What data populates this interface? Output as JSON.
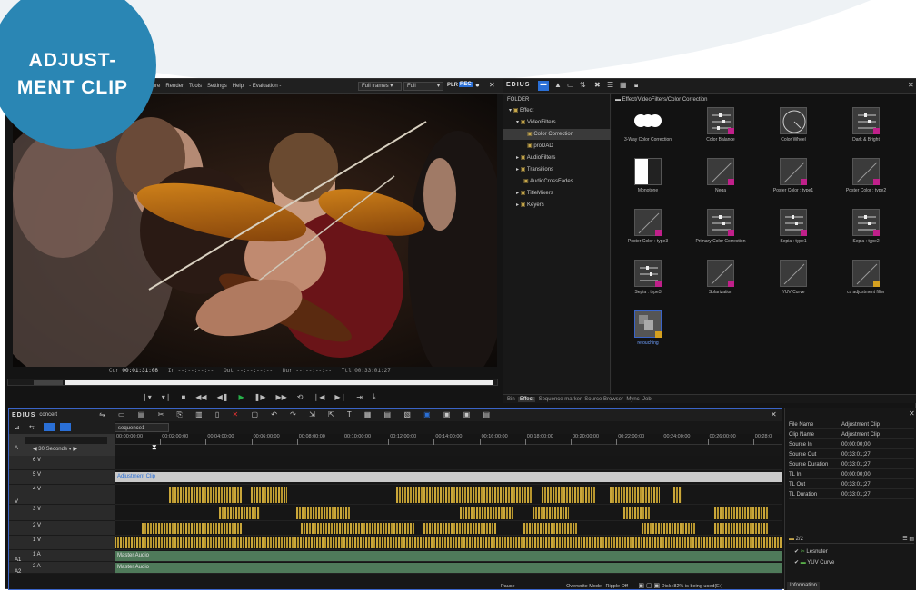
{
  "badge": {
    "line1": "ADJUST-",
    "line2": "MENT CLIP"
  },
  "player": {
    "menu": [
      "ture",
      "Render",
      "Tools",
      "Settings",
      "Help",
      "- Evaluation -"
    ],
    "frames_select": "Full frames",
    "quality_select": "Full",
    "plr": "PLR",
    "rec": "REC",
    "cur_label": "Cur",
    "cur_value": "00:01:31:08",
    "in_label": "In",
    "in_value": "--:--:--:--",
    "out_label": "Out",
    "out_value": "--:--:--:--",
    "dur_label": "Dur",
    "dur_value": "--:--:--:--",
    "ttl_label": "Ttl",
    "ttl_value": "00:33:01:27"
  },
  "effects": {
    "app_name": "EDIUS",
    "folder_header": "FOLDER",
    "path": "Effect/VideoFilters/Color Correction",
    "tree": [
      "Effect",
      "VideoFilters",
      "Color Correction",
      "proDAD",
      "AudioFilters",
      "Transitions",
      "AudioCrossFades",
      "TitleMixers",
      "Keyers"
    ],
    "items": [
      "3-Way Color Correction",
      "Color Balance",
      "Color Wheel",
      "Dark & Bright",
      "Monotone",
      "Nega",
      "Poster Color : type1",
      "Poster Color : type2",
      "Poster Color : type3",
      "Primary Color Correction",
      "Sepia : type1",
      "Sepia : type2",
      "Sepia : type3",
      "Solarization",
      "YUV Curve",
      "cc adjustment filter",
      "retouching"
    ],
    "tabs": [
      "Bin",
      "Effect",
      "Sequence marker",
      "Source Browser",
      "Mync",
      "Job"
    ]
  },
  "timeline": {
    "title": "EDIUS",
    "project": "concert",
    "sequence": "sequence1",
    "scale": "30 Seconds",
    "ruler": [
      "00:00:00:00",
      "00:02:00:00",
      "00:04:00:00",
      "00:06:00:00",
      "00:08:00:00",
      "00:10:00:00",
      "00:12:00:00",
      "00:14:00:00",
      "00:16:00:00",
      "00:18:00:00",
      "00:20:00:00",
      "00:22:00:00",
      "00:24:00:00",
      "00:26:00:00",
      "00:28:0"
    ],
    "tracks": [
      "6 V",
      "5 V",
      "4 V",
      "3 V",
      "2 V",
      "1 V",
      "1 A",
      "2 A"
    ],
    "side_v": "V",
    "side_a": "A",
    "side_a1": "A1",
    "side_a2": "A2",
    "adjustment_clip": "Adjustment Clip",
    "master_audio_1": "Master Audio",
    "master_audio_2": "Master Audio"
  },
  "status": {
    "pause": "Pause",
    "mode": "Overwrite Mode",
    "ripple": "Ripple Off",
    "disk": "Disk :82% is being used(E:)"
  },
  "info": {
    "rows": [
      [
        "File Name",
        "Adjustment Clip"
      ],
      [
        "Clip Name",
        "Adjustment Clip"
      ],
      [
        "Source In",
        "00:00:00;00"
      ],
      [
        "Source Out",
        "00:33:01;27"
      ],
      [
        "Source Duration",
        "00:33:01;27"
      ],
      [
        "TL In",
        "00:00:00;00"
      ],
      [
        "TL Out",
        "00:33:01;27"
      ],
      [
        "TL Duration",
        "00:33:01;27"
      ]
    ],
    "count": "2/2",
    "filters": [
      "Lesnuter",
      "YUV Curve"
    ],
    "tab": "Information"
  }
}
